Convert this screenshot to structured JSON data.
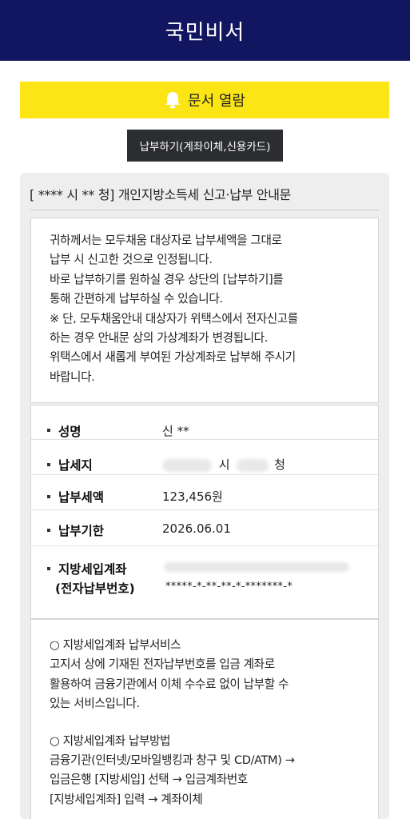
{
  "header": {
    "title": "국민비서"
  },
  "open_document": {
    "label": "문서 열람",
    "icon": "bell-icon",
    "background": "#fbe514"
  },
  "pay_button": {
    "label": "납부하기(계좌이체,신용카드)"
  },
  "document": {
    "title": "[      **** 시  **   청] 개인지방소득세 신고·납부 안내문",
    "notice_lines": [
      "귀하께서는 모두채움 대상자로 납부세액을 그대로",
      "납부 시 신고한 것으로 인정됩니다.",
      "바로 납부하기를 원하실 경우 상단의 [납부하기]를",
      "통해 간편하게 납부하실 수 있습니다.",
      "※ 단, 모두채움안내 대상자가 위택스에서 전자신고를",
      "하는 경우 안내문 상의 가상계좌가 변경됩니다.",
      "위택스에서 새롭게 부여된 가상계좌로 납부해 주시기",
      "바랍니다."
    ],
    "info": {
      "name": {
        "label": "성명",
        "value": "신 **"
      },
      "location": {
        "label": "납세지",
        "value_city": "시",
        "value_office": "청"
      },
      "amount": {
        "label": "납부세액",
        "value": "123,456원"
      },
      "due_date": {
        "label": "납부기한",
        "value": "2026.06.01"
      },
      "account": {
        "label_line1": "지방세입계좌",
        "label_line2": "(전자납부번호)",
        "value": "*****-*-**-**-*-*******-*"
      }
    },
    "service": {
      "section1_title": "○ 지방세입계좌 납부서비스",
      "section1_lines": [
        "고지서 상에 기재된 전자납부번호를 입금 계좌로",
        "활용하여 금융기관에서 이체 수수료 없이 납부할 수",
        "있는 서비스입니다."
      ],
      "section2_title": "○ 지방세입계좌 납부방법",
      "section2_lines": [
        "금융기관(인터넷/모바일뱅킹과 창구 및 CD/ATM) →",
        "입금은행 [지방세입] 선택 → 입금계좌번호",
        "[지방세입계좌] 입력 → 계좌이체"
      ]
    }
  }
}
